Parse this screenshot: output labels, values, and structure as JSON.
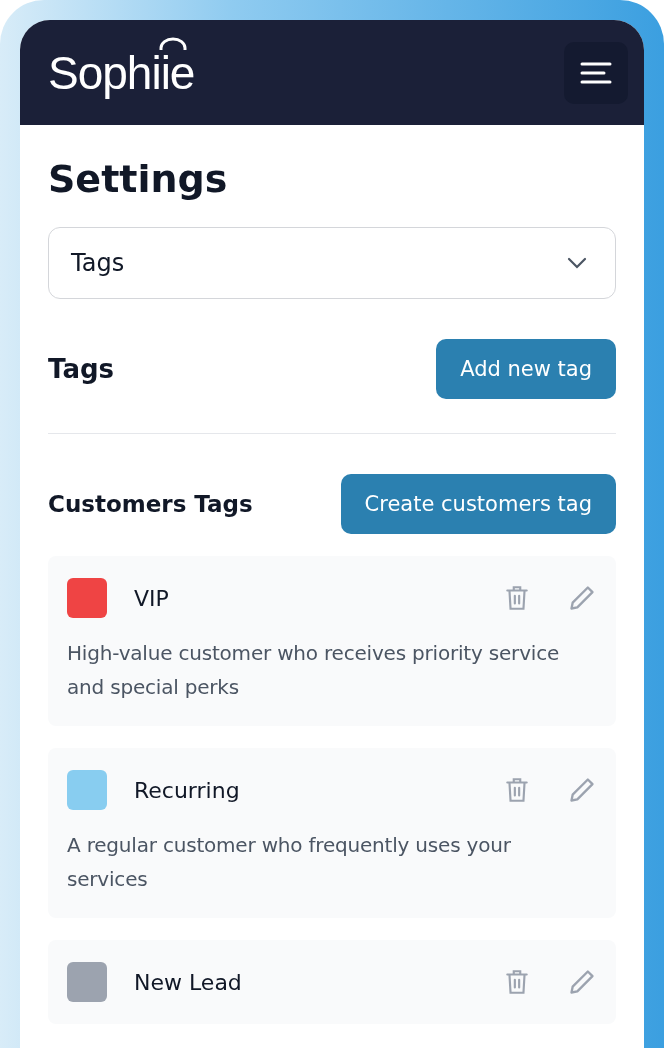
{
  "header": {
    "logo": "Sophiie"
  },
  "page": {
    "title": "Settings"
  },
  "section_select": {
    "value": "Tags"
  },
  "tags_section": {
    "title": "Tags",
    "button": "Add new tag"
  },
  "customers_tags": {
    "title": "Customers Tags",
    "button": "Create customers tag",
    "items": [
      {
        "name": "VIP",
        "color": "#ef4444",
        "description": "High-value customer who receives priority service and special perks"
      },
      {
        "name": "Recurring",
        "color": "#88cdf0",
        "description": "A regular customer who frequently uses your services"
      },
      {
        "name": "New Lead",
        "color": "#9ca3af"
      }
    ]
  }
}
